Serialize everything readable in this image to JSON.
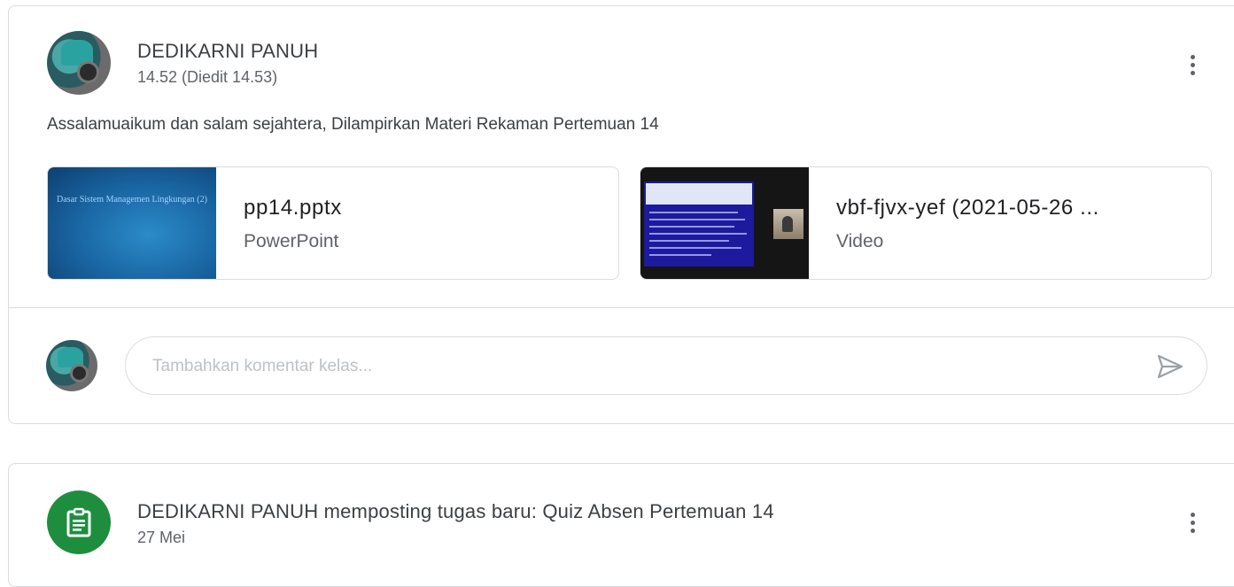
{
  "post": {
    "author": "DEDIKARNI PANUH",
    "timestamp": "14.52 (Diedit 14.53)",
    "message": "Assalamuaikum dan salam sejahtera, Dilampirkan Materi Rekaman Pertemuan 14",
    "attachments": [
      {
        "name": "pp14.pptx",
        "type": "PowerPoint",
        "thumbnail_text": "Dasar Sistem Managemen Lingkungan (2)",
        "icon": "powerpoint-thumbnail"
      },
      {
        "name": "vbf-fjvx-yef (2021-05-26 ...",
        "type": "Video",
        "icon": "video-thumbnail"
      }
    ],
    "comment": {
      "placeholder": "Tambahkan komentar kelas...",
      "value": ""
    }
  },
  "assignment_post": {
    "title": "DEDIKARNI PANUH memposting tugas baru: Quiz Absen Pertemuan 14",
    "date": "27 Mei",
    "icon": "assignment-icon"
  },
  "colors": {
    "assignment_green": "#1e8e3e",
    "text_primary": "#3c4043",
    "text_secondary": "#5f6368",
    "border": "#dadce0"
  },
  "icons": {
    "more": "more-vert-icon",
    "send": "send-icon"
  }
}
